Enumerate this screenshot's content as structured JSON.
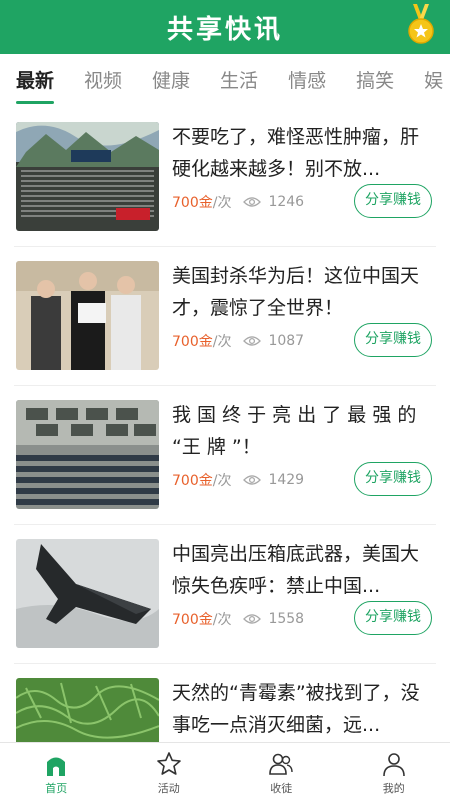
{
  "header": {
    "title": "共享快讯",
    "medal_icon": "medal-icon"
  },
  "tabs": [
    {
      "label": "最新",
      "active": true
    },
    {
      "label": "视频"
    },
    {
      "label": "健康"
    },
    {
      "label": "生活"
    },
    {
      "label": "情感"
    },
    {
      "label": "搞笑"
    },
    {
      "label": "娱"
    }
  ],
  "articles": [
    {
      "title": "不要吃了，难怪恶性肿瘤，肝硬化越来越多！别不放...",
      "reward": "700金",
      "per": "/次",
      "views": "1246",
      "button": "分享赚钱"
    },
    {
      "title": "美国封杀华为后！这位中国天才，震惊了全世界！",
      "reward": "700金",
      "per": "/次",
      "views": "1087",
      "button": "分享赚钱"
    },
    {
      "title": "我 国 终 于 亮 出 了 最 强 的 “王 牌 ”！",
      "reward": "700金",
      "per": "/次",
      "views": "1429",
      "button": "分享赚钱"
    },
    {
      "title": "中国亮出压箱底武器，美国大惊失色疾呼：禁止中国...",
      "reward": "700金",
      "per": "/次",
      "views": "1558",
      "button": "分享赚钱"
    },
    {
      "title": "天然的“青霉素”被找到了，没事吃一点消灭细菌，远...",
      "reward": "",
      "per": "",
      "views": "",
      "button": ""
    }
  ],
  "nav": [
    {
      "label": "首页",
      "icon": "home-icon",
      "active": true
    },
    {
      "label": "活动",
      "icon": "star-icon"
    },
    {
      "label": "收徒",
      "icon": "users-icon"
    },
    {
      "label": "我的",
      "icon": "person-icon"
    }
  ],
  "colors": {
    "brand": "#1fa463",
    "reward": "#e8612c"
  }
}
